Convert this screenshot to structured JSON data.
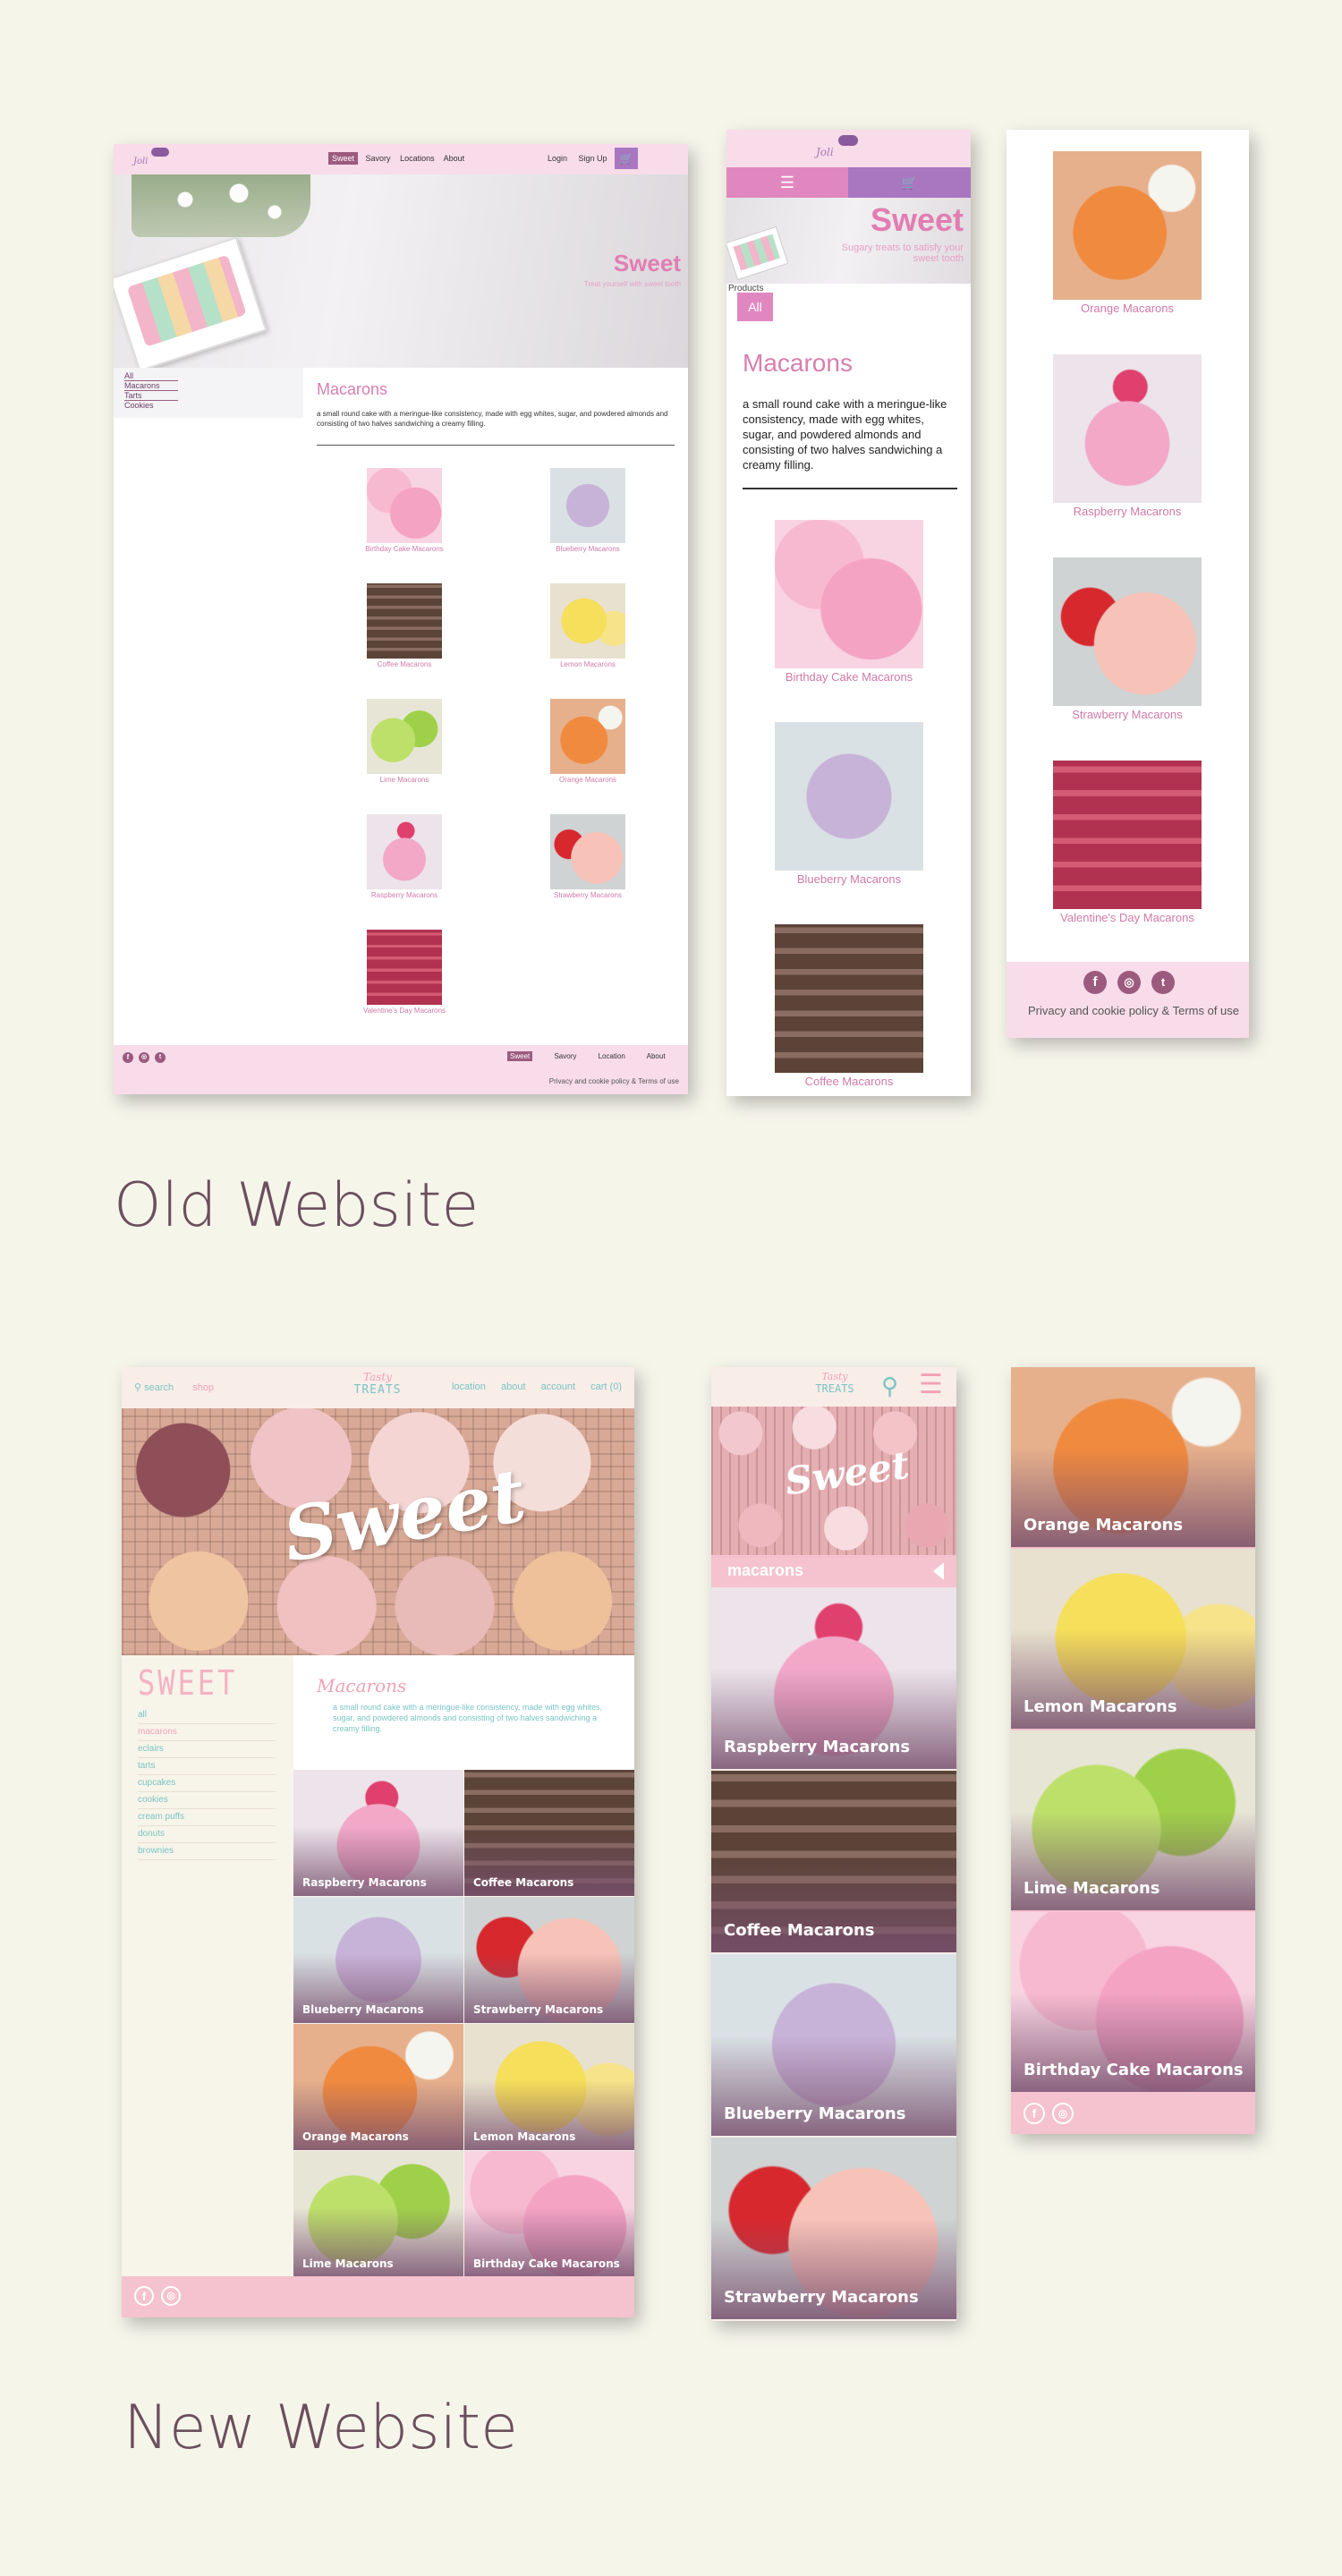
{
  "old_section_label": "Old Website",
  "new_section_label": "New Website",
  "old_desktop": {
    "nav": [
      "Sweet",
      "Savory",
      "Locations",
      "About"
    ],
    "login": "Login",
    "signup": "Sign Up",
    "hero_title": "Sweet",
    "hero_subtitle": "Treat yourself with sweet tooth",
    "sidebar": [
      "All",
      "Macarons",
      "Tarts",
      "Cookies"
    ],
    "heading": "Macarons",
    "desc": "a small round cake with a meringue-like consistency, made with egg whites, sugar, and powdered almonds and consisting of two halves sandwiching a creamy filling.",
    "products": [
      "Birthday Cake Macarons",
      "Blueberry Macarons",
      "Coffee Macarons",
      "Lemon Macarons",
      "Lime Macarons",
      "Orange Macarons",
      "Raspberry Macarons",
      "Strawberry Macarons",
      "Valentine's Day Macarons"
    ],
    "footer_nav": [
      "Sweet",
      "Savory",
      "Location",
      "About"
    ],
    "footer_privacy": "Privacy and cookie policy & Terms of use"
  },
  "old_mobile1": {
    "hero_title": "Sweet",
    "hero_subtitle": "Sugary treats to satisfy your sweet tooth",
    "products_label": "Products",
    "all_btn": "All",
    "heading": "Macarons",
    "desc": "a small round cake with a meringue-like consistency, made with egg whites, sugar, and powdered almonds and consisting of two halves sandwiching a creamy filling.",
    "products": [
      "Birthday Cake Macarons",
      "Blueberry Macarons",
      "Coffee Macarons"
    ]
  },
  "old_mobile2": {
    "products": [
      "Orange Macarons",
      "Raspberry Macarons",
      "Strawberry Macarons",
      "Valentine's Day Macarons"
    ],
    "footer_privacy": "Privacy and cookie policy & Terms of use"
  },
  "new_desktop": {
    "search": "search",
    "shop": "shop",
    "nav": [
      "location",
      "about",
      "account",
      "cart (0)"
    ],
    "hero_title": "Sweet",
    "sidebar_title": "SWEET",
    "sidebar": [
      "all",
      "macarons",
      "eclairs",
      "tarts",
      "cupcakes",
      "cookies",
      "cream puffs",
      "donuts",
      "brownies"
    ],
    "heading": "Macarons",
    "desc": "a small round cake with a meringue-like consistency, made with egg whites, sugar, and powdered almonds and consisting of two halves sandwiching a creamy filling.",
    "products": [
      "Raspberry Macarons",
      "Coffee Macarons",
      "Blueberry Macarons",
      "Strawberry Macarons",
      "Orange Macarons",
      "Lemon Macarons",
      "Lime Macarons",
      "Birthday Cake Macarons"
    ]
  },
  "new_mobile1": {
    "hero_title": "Sweet",
    "category": "macarons",
    "products": [
      "Raspberry Macarons",
      "Coffee Macarons",
      "Blueberry Macarons",
      "Strawberry Macarons"
    ]
  },
  "new_mobile2": {
    "products": [
      "Orange Macarons",
      "Lemon Macarons",
      "Lime Macarons",
      "Birthday Cake Macarons"
    ]
  },
  "colors": {
    "pink": "#d77fb0",
    "soft_pink": "#f7dbe8",
    "purple": "#9a6fb5",
    "new_pink": "#f5c2cf",
    "teal": "#7ac4c4"
  }
}
